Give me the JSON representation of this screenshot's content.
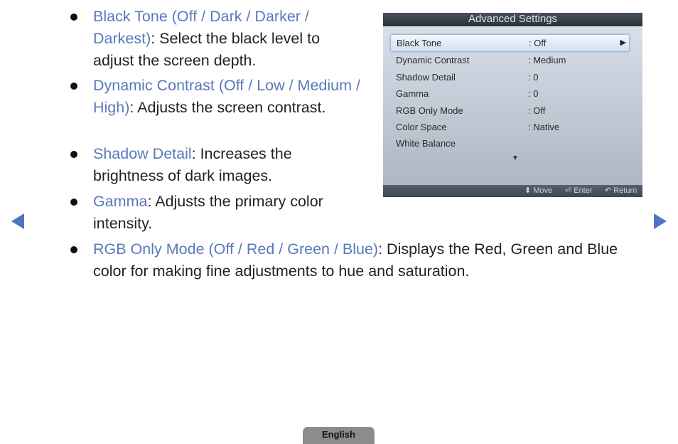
{
  "bullets": [
    {
      "term": "Black Tone (Off / Dark / Darker / Darkest)",
      "desc": ": Select the black level to adjust the screen depth."
    },
    {
      "term": "Dynamic Contrast (Off / Low / Medium / High)",
      "desc": ": Adjusts the screen contrast."
    },
    {
      "term": "Shadow Detail",
      "desc": ": Increases the brightness of dark images."
    },
    {
      "term": "Gamma",
      "desc": ": Adjusts the primary color intensity."
    },
    {
      "term": "RGB Only Mode (Off / Red / Green / Blue)",
      "desc": ": Displays the Red, Green and Blue color for making fine adjustments to hue and saturation."
    }
  ],
  "osd": {
    "title": "Advanced Settings",
    "rows": [
      {
        "label": "Black Tone",
        "value": ": Off"
      },
      {
        "label": "Dynamic Contrast",
        "value": ": Medium"
      },
      {
        "label": "Shadow Detail",
        "value": ": 0"
      },
      {
        "label": "Gamma",
        "value": ": 0"
      },
      {
        "label": "RGB Only Mode",
        "value": ": Off"
      },
      {
        "label": "Color Space",
        "value": ": Native"
      },
      {
        "label": "White Balance",
        "value": ""
      }
    ],
    "selected_arrow": "▶",
    "scroll_down": "▼",
    "footer": {
      "move": {
        "icon": "⬍",
        "label": "Move"
      },
      "enter": {
        "icon": "⏎",
        "label": "Enter"
      },
      "return": {
        "icon": "↶",
        "label": "Return"
      }
    }
  },
  "language_tab": "English"
}
